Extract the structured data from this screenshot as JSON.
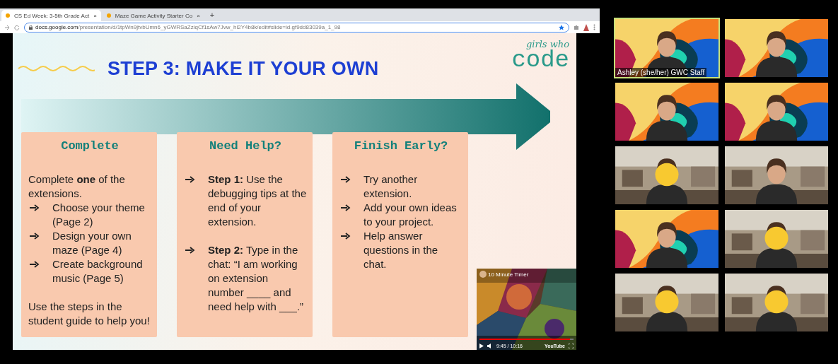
{
  "browser": {
    "tabs": [
      {
        "title": "CS Ed Week: 3-5th Grade Act",
        "close": "×",
        "selected": true
      },
      {
        "title": "Maze Game Activity Starter Co",
        "close": "×",
        "selected": false
      }
    ],
    "new_tab": "+",
    "url_host": "docs.google.com",
    "url_path": "/presentation/d/1tpWn9jtvbUmn6_yGWRSaZziqCf1sAw7Jvw_hl2Y4b8k/edit#slide=id.gf9dd83039a_1_98"
  },
  "slide": {
    "title": "STEP 3: MAKE IT YOUR OWN",
    "logo": {
      "line_1": "girls who",
      "line_2": "code"
    },
    "columns": [
      {
        "heading": "Complete",
        "items": [
          {
            "kind": "text",
            "text": "Complete **one** of the extensions."
          },
          {
            "kind": "bullet",
            "text": "Choose your theme (Page 2)"
          },
          {
            "kind": "bullet",
            "text": "Design your own maze (Page 4)"
          },
          {
            "kind": "bullet",
            "text": "Create background music (Page 5)"
          },
          {
            "kind": "gap"
          },
          {
            "kind": "text",
            "text": "Use the steps in the student guide to help you!"
          }
        ]
      },
      {
        "heading": "Need Help?",
        "items": [
          {
            "kind": "bullet",
            "text": "**Step 1:** Use the debugging tips at the end of your extension."
          },
          {
            "kind": "gap"
          },
          {
            "kind": "bullet",
            "text": "**Step 2:** Type in the chat: “I am working on extension number ____ and need help with ___.”"
          }
        ]
      },
      {
        "heading": "Finish Early?",
        "items": [
          {
            "kind": "bullet",
            "text": "Try another extension."
          },
          {
            "kind": "bullet",
            "text": "Add your own ideas to your project."
          },
          {
            "kind": "bullet",
            "text": "Help answer questions in the chat."
          }
        ]
      }
    ],
    "video": {
      "title": "10 Minute Timer",
      "time": "9:45 / 10:16",
      "brand": "YouTube",
      "level": 0.96
    }
  },
  "participants": [
    {
      "name": "Ashley (she/her) GWC Staff",
      "speaking": true,
      "kind": "art",
      "sticker": false
    },
    {
      "speaking": false,
      "kind": "art",
      "sticker": false
    },
    {
      "speaking": false,
      "kind": "art",
      "sticker": false
    },
    {
      "speaking": false,
      "kind": "art",
      "sticker": false
    },
    {
      "speaking": false,
      "kind": "room",
      "sticker": true
    },
    {
      "speaking": false,
      "kind": "room",
      "sticker": false
    },
    {
      "speaking": false,
      "kind": "art",
      "sticker": false
    },
    {
      "speaking": false,
      "kind": "room",
      "sticker": true
    },
    {
      "speaking": false,
      "kind": "room",
      "sticker": true
    },
    {
      "speaking": false,
      "kind": "room",
      "sticker": true
    }
  ]
}
